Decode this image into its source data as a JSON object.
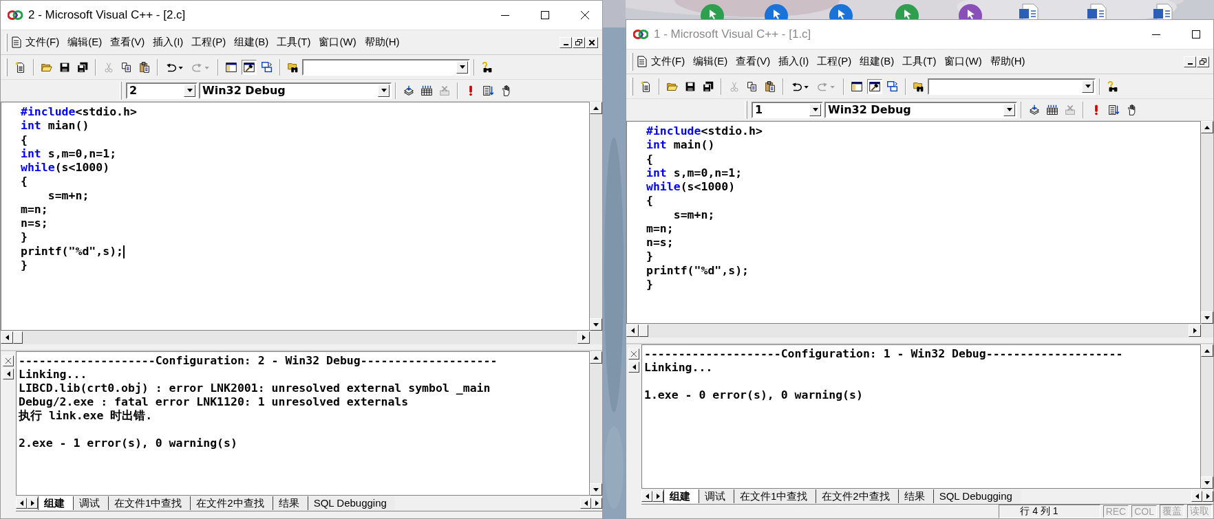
{
  "desktop": {
    "kind": "picture",
    "icons": [
      {
        "kind": "app",
        "color": "#2e9e4f"
      },
      {
        "kind": "app",
        "color": "#1a73d9"
      },
      {
        "kind": "app",
        "color": "#1a73d9"
      },
      {
        "kind": "app",
        "color": "#2e9e4f"
      },
      {
        "kind": "app",
        "color": "#8a4fb8"
      },
      {
        "kind": "document"
      },
      {
        "kind": "document"
      },
      {
        "kind": "document"
      }
    ]
  },
  "toolbars": {
    "standard": [
      {
        "kind": "new",
        "disabled": false,
        "pressed": false
      },
      {
        "kind": "separator"
      },
      {
        "kind": "open",
        "disabled": false,
        "pressed": false
      },
      {
        "kind": "save",
        "disabled": false,
        "pressed": false
      },
      {
        "kind": "save_all",
        "disabled": false,
        "pressed": false
      },
      {
        "kind": "separator"
      },
      {
        "kind": "cut",
        "disabled": true,
        "pressed": false
      },
      {
        "kind": "copy",
        "disabled": false,
        "pressed": false
      },
      {
        "kind": "paste",
        "disabled": false,
        "pressed": false
      },
      {
        "kind": "separator"
      },
      {
        "kind": "undo",
        "disabled": false,
        "pressed": false
      },
      {
        "kind": "redo",
        "disabled": true,
        "pressed": false
      },
      {
        "kind": "separator"
      },
      {
        "kind": "workspace",
        "disabled": false,
        "pressed": false
      },
      {
        "kind": "output",
        "disabled": false,
        "pressed": true
      },
      {
        "kind": "window_list",
        "disabled": false,
        "pressed": false
      },
      {
        "kind": "separator"
      },
      {
        "kind": "find_in_files",
        "disabled": false,
        "pressed": false
      },
      {
        "kind": "find_combo"
      },
      {
        "kind": "separator"
      },
      {
        "kind": "search_help",
        "disabled": false,
        "pressed": false
      }
    ],
    "build": [
      {
        "kind": "compile",
        "disabled": false,
        "pressed": false
      },
      {
        "kind": "build",
        "disabled": false,
        "pressed": false
      },
      {
        "kind": "stop",
        "disabled": true,
        "pressed": false
      },
      {
        "kind": "separator"
      },
      {
        "kind": "execute",
        "disabled": false,
        "pressed": false
      },
      {
        "kind": "go",
        "disabled": false,
        "pressed": false
      },
      {
        "kind": "breakpoint",
        "disabled": false,
        "pressed": false
      }
    ]
  },
  "windows": [
    {
      "title": "2 - Microsoft Visual C++ - [2.c]",
      "active": true,
      "title_buttons": [
        {
          "kind": "minimize"
        },
        {
          "kind": "maximize"
        },
        {
          "kind": "close"
        }
      ],
      "menu": [
        "文件(F)",
        "编辑(E)",
        "查看(V)",
        "插入(I)",
        "工程(P)",
        "组建(B)",
        "工具(T)",
        "窗口(W)",
        "帮助(H)"
      ],
      "mdi_buttons": [
        {
          "kind": "minimize"
        },
        {
          "kind": "restore"
        },
        {
          "kind": "close"
        }
      ],
      "project": "2",
      "configuration": "Win32 Debug",
      "code": [
        {
          "segments": [
            {
              "text": "#include",
              "kind": "keyword"
            },
            {
              "text": "<stdio.h>",
              "kind": "plain"
            }
          ],
          "caret": false
        },
        {
          "segments": [
            {
              "text": "int",
              "kind": "keyword"
            },
            {
              "text": " mian()",
              "kind": "plain"
            }
          ],
          "caret": false
        },
        {
          "segments": [
            {
              "text": "{",
              "kind": "plain"
            }
          ],
          "caret": false
        },
        {
          "segments": [
            {
              "text": "int",
              "kind": "keyword"
            },
            {
              "text": " s,m=0,n=1;",
              "kind": "plain"
            }
          ],
          "caret": false
        },
        {
          "segments": [
            {
              "text": "while",
              "kind": "keyword"
            },
            {
              "text": "(s<1000)",
              "kind": "plain"
            }
          ],
          "caret": false
        },
        {
          "segments": [
            {
              "text": "{",
              "kind": "plain"
            }
          ],
          "caret": false
        },
        {
          "segments": [
            {
              "text": "    s=m+n;",
              "kind": "plain"
            }
          ],
          "caret": false
        },
        {
          "segments": [
            {
              "text": "m=n;",
              "kind": "plain"
            }
          ],
          "caret": false
        },
        {
          "segments": [
            {
              "text": "n=s;",
              "kind": "plain"
            }
          ],
          "caret": false
        },
        {
          "segments": [
            {
              "text": "}",
              "kind": "plain"
            }
          ],
          "caret": false
        },
        {
          "segments": [
            {
              "text": "printf(\"%d\",s);",
              "kind": "plain"
            }
          ],
          "caret": true
        },
        {
          "segments": [
            {
              "text": "}",
              "kind": "plain"
            }
          ],
          "caret": false
        }
      ],
      "output_blocks": [
        [
          "--------------------Configuration: 2 - Win32 Debug--------------------",
          "Linking...",
          "LIBCD.lib(crt0.obj) : error LNK2001: unresolved external symbol _main",
          "Debug/2.exe : fatal error LNK1120: 1 unresolved externals",
          "执行 link.exe 时出错."
        ],
        [
          "2.exe - 1 error(s), 0 warning(s)"
        ]
      ],
      "output_tabs": [
        {
          "label": "组建",
          "selected": true
        },
        {
          "label": "调试",
          "selected": false
        },
        {
          "label": "在文件1中查找",
          "selected": false
        },
        {
          "label": "在文件2中查找",
          "selected": false
        },
        {
          "label": "结果",
          "selected": false
        },
        {
          "label": "SQL Debugging",
          "selected": false
        }
      ]
    },
    {
      "title": "1 - Microsoft Visual C++ - [1.c]",
      "active": false,
      "title_buttons": [
        {
          "kind": "minimize"
        },
        {
          "kind": "maximize"
        }
      ],
      "menu": [
        "文件(F)",
        "编辑(E)",
        "查看(V)",
        "插入(I)",
        "工程(P)",
        "组建(B)",
        "工具(T)",
        "窗口(W)",
        "帮助(H)"
      ],
      "mdi_buttons": [
        {
          "kind": "minimize"
        },
        {
          "kind": "restore"
        }
      ],
      "project": "1",
      "configuration": "Win32 Debug",
      "code": [
        {
          "segments": [
            {
              "text": "#include",
              "kind": "keyword"
            },
            {
              "text": "<stdio.h>",
              "kind": "plain"
            }
          ],
          "caret": false
        },
        {
          "segments": [
            {
              "text": "int",
              "kind": "keyword"
            },
            {
              "text": " main()",
              "kind": "plain"
            }
          ],
          "caret": false
        },
        {
          "segments": [
            {
              "text": "{",
              "kind": "plain"
            }
          ],
          "caret": false
        },
        {
          "segments": [
            {
              "text": "int",
              "kind": "keyword"
            },
            {
              "text": " s,m=0,n=1;",
              "kind": "plain"
            }
          ],
          "caret": false
        },
        {
          "segments": [
            {
              "text": "while",
              "kind": "keyword"
            },
            {
              "text": "(s<1000)",
              "kind": "plain"
            }
          ],
          "caret": false
        },
        {
          "segments": [
            {
              "text": "{",
              "kind": "plain"
            }
          ],
          "caret": false
        },
        {
          "segments": [
            {
              "text": "    s=m+n;",
              "kind": "plain"
            }
          ],
          "caret": false
        },
        {
          "segments": [
            {
              "text": "m=n;",
              "kind": "plain"
            }
          ],
          "caret": false
        },
        {
          "segments": [
            {
              "text": "n=s;",
              "kind": "plain"
            }
          ],
          "caret": false
        },
        {
          "segments": [
            {
              "text": "}",
              "kind": "plain"
            }
          ],
          "caret": false
        },
        {
          "segments": [
            {
              "text": "printf(\"%d\",s);",
              "kind": "plain"
            }
          ],
          "caret": false
        },
        {
          "segments": [
            {
              "text": "}",
              "kind": "plain"
            }
          ],
          "caret": false
        }
      ],
      "output_blocks": [
        [
          "--------------------Configuration: 1 - Win32 Debug--------------------",
          "Linking..."
        ],
        [
          "1.exe - 0 error(s), 0 warning(s)"
        ]
      ],
      "output_tabs": [
        {
          "label": "组建",
          "selected": true
        },
        {
          "label": "调试",
          "selected": false
        },
        {
          "label": "在文件1中查找",
          "selected": false
        },
        {
          "label": "在文件2中查找",
          "selected": false
        },
        {
          "label": "结果",
          "selected": false
        },
        {
          "label": "SQL Debugging",
          "selected": false
        }
      ],
      "status_bar": {
        "position": "行 4 列 1",
        "indicators": [
          {
            "text": "REC",
            "enabled": false
          },
          {
            "text": "COL",
            "enabled": false
          },
          {
            "text": "覆盖",
            "enabled": false
          },
          {
            "text": "读取",
            "enabled": false
          }
        ]
      }
    }
  ]
}
